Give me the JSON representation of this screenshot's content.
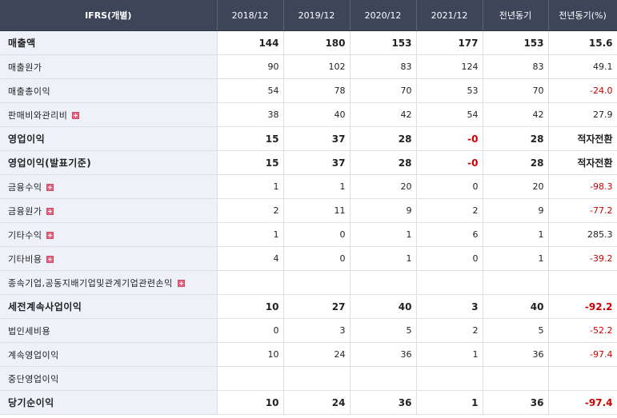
{
  "header": {
    "label": "IFRS(개별)",
    "cols": [
      "2018/12",
      "2019/12",
      "2020/12",
      "2021/12",
      "전년동기",
      "전년동기(%)"
    ]
  },
  "rows": [
    {
      "label": "매출액",
      "bold": true,
      "plus": false,
      "values": [
        "144",
        "180",
        "153",
        "177",
        "153",
        "15.6"
      ]
    },
    {
      "label": "매출원가",
      "bold": false,
      "plus": false,
      "values": [
        "90",
        "102",
        "83",
        "124",
        "83",
        "49.1"
      ]
    },
    {
      "label": "매출총이익",
      "bold": false,
      "plus": false,
      "values": [
        "54",
        "78",
        "70",
        "53",
        "70",
        "-24.0"
      ]
    },
    {
      "label": "판매비와관리비",
      "bold": false,
      "plus": true,
      "values": [
        "38",
        "40",
        "42",
        "54",
        "42",
        "27.9"
      ]
    },
    {
      "label": "영업이익",
      "bold": true,
      "plus": false,
      "values": [
        "15",
        "37",
        "28",
        "-0",
        "28",
        "적자전환"
      ]
    },
    {
      "label": "영업이익(발표기준)",
      "bold": true,
      "plus": false,
      "values": [
        "15",
        "37",
        "28",
        "-0",
        "28",
        "적자전환"
      ]
    },
    {
      "label": "금융수익",
      "bold": false,
      "plus": true,
      "values": [
        "1",
        "1",
        "20",
        "0",
        "20",
        "-98.3"
      ]
    },
    {
      "label": "금융원가",
      "bold": false,
      "plus": true,
      "values": [
        "2",
        "11",
        "9",
        "2",
        "9",
        "-77.2"
      ]
    },
    {
      "label": "기타수익",
      "bold": false,
      "plus": true,
      "values": [
        "1",
        "0",
        "1",
        "6",
        "1",
        "285.3"
      ]
    },
    {
      "label": "기타비용",
      "bold": false,
      "plus": true,
      "values": [
        "4",
        "0",
        "1",
        "0",
        "1",
        "-39.2"
      ]
    },
    {
      "label": "종속기업,공동지배기업및관계기업관련손익",
      "bold": false,
      "plus": true,
      "values": [
        "",
        "",
        "",
        "",
        "",
        ""
      ]
    },
    {
      "label": "세전계속사업이익",
      "bold": true,
      "plus": false,
      "values": [
        "10",
        "27",
        "40",
        "3",
        "40",
        "-92.2"
      ]
    },
    {
      "label": "법인세비용",
      "bold": false,
      "plus": false,
      "values": [
        "0",
        "3",
        "5",
        "2",
        "5",
        "-52.2"
      ]
    },
    {
      "label": "계속영업이익",
      "bold": false,
      "plus": false,
      "values": [
        "10",
        "24",
        "36",
        "1",
        "36",
        "-97.4"
      ]
    },
    {
      "label": "중단영업이익",
      "bold": false,
      "plus": false,
      "values": [
        "",
        "",
        "",
        "",
        "",
        ""
      ]
    },
    {
      "label": "당기순이익",
      "bold": true,
      "plus": false,
      "values": [
        "10",
        "24",
        "36",
        "1",
        "36",
        "-97.4"
      ]
    }
  ],
  "colors": {
    "header_bg": "#3d4659",
    "label_bg": "#eef1f7",
    "negative": "#cc0000",
    "plus_icon": "#e8637c"
  }
}
